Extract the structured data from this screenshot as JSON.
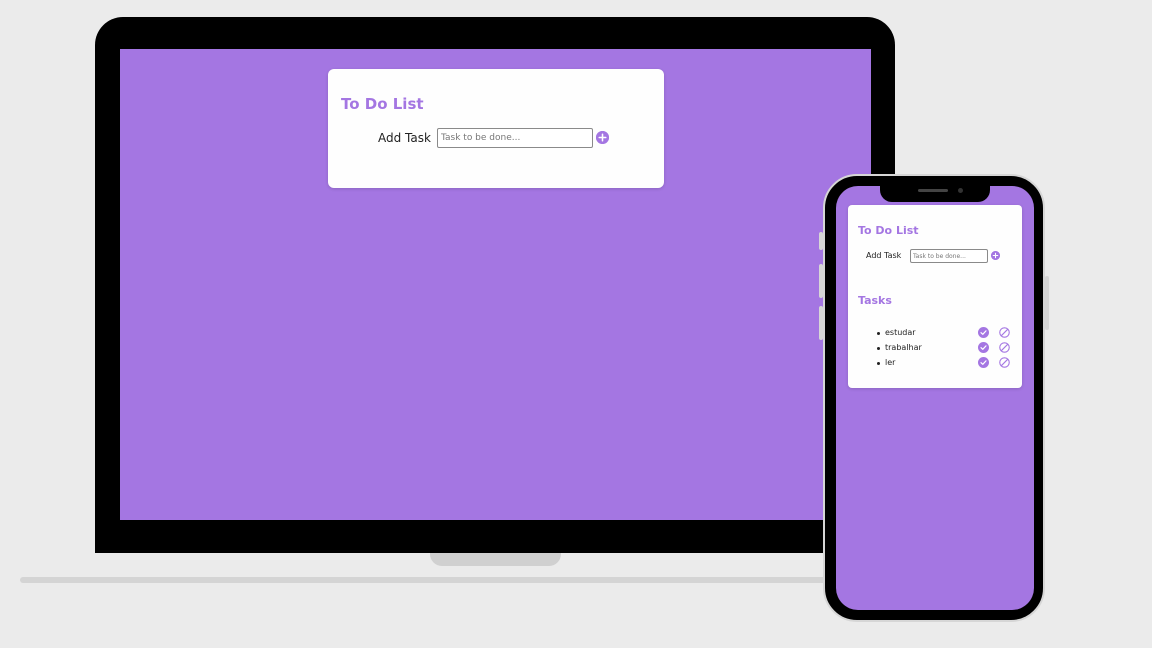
{
  "colors": {
    "accent": "#a476e2",
    "screen_background": "#a476e2",
    "page_background": "#ebebeb",
    "card_background": "#fefefe"
  },
  "desktop_app": {
    "title": "To Do List",
    "add_task_label": "Add Task",
    "task_input": {
      "placeholder": "Task to be done...",
      "value": ""
    },
    "add_button_icon": "plus-circle-icon"
  },
  "mobile_app": {
    "title": "To Do List",
    "add_task_label": "Add Task",
    "task_input": {
      "placeholder": "Task to be done...",
      "value": ""
    },
    "add_button_icon": "plus-circle-icon",
    "tasks_heading": "Tasks",
    "tasks": [
      {
        "text": "estudar",
        "done_icon": "check-circle-icon",
        "remove_icon": "ban-icon"
      },
      {
        "text": "trabalhar",
        "done_icon": "check-circle-icon",
        "remove_icon": "ban-icon"
      },
      {
        "text": "ler",
        "done_icon": "check-circle-icon",
        "remove_icon": "ban-icon"
      }
    ]
  }
}
